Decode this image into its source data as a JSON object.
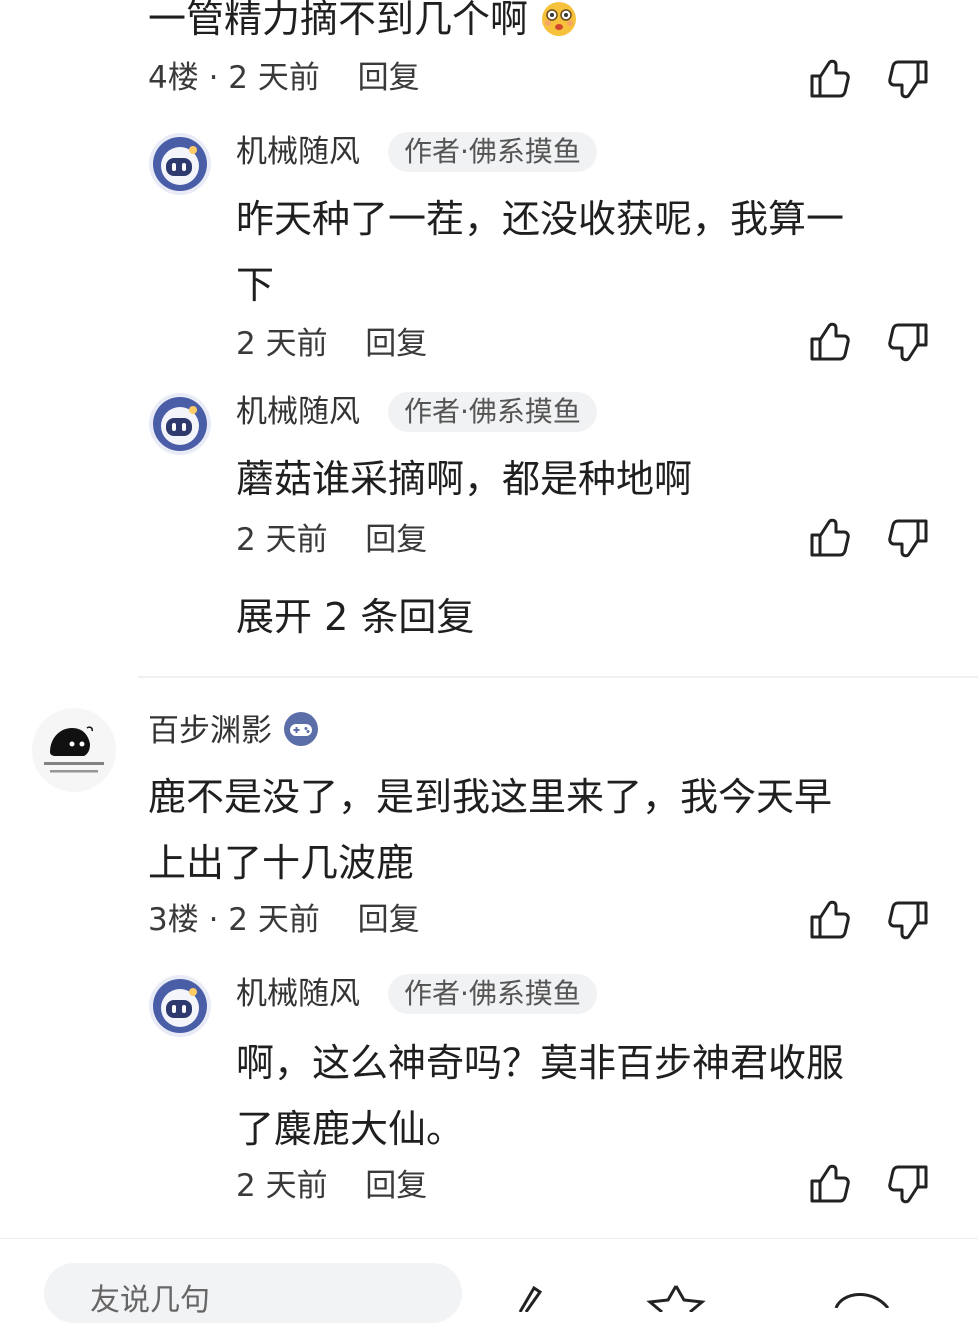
{
  "thread": {
    "prev_comment_tail": "一管精力摘不到几个啊",
    "comments": [
      {
        "floor_meta": "4楼 · 2 天前",
        "reply_label": "回复",
        "replies": [
          {
            "author": "机械随风",
            "badge": "作者·佛系摸鱼",
            "text_line1": "昨天种了一茬，还没收获呢，我算一",
            "text_line2": "下",
            "meta": "2 天前",
            "reply_label": "回复"
          },
          {
            "author": "机械随风",
            "badge": "作者·佛系摸鱼",
            "text_line1": "蘑菇谁采摘啊，都是种地啊",
            "meta": "2 天前",
            "reply_label": "回复"
          }
        ],
        "expand_label": "展开 2 条回复"
      },
      {
        "author": "百步渊影",
        "text_line1": "鹿不是没了，是到我这里来了，我今天早",
        "text_line2": "上出了十几波鹿",
        "floor_meta": "3楼 · 2 天前",
        "reply_label": "回复",
        "replies": [
          {
            "author": "机械随风",
            "badge": "作者·佛系摸鱼",
            "text_line1": "啊，这么神奇吗？莫非百步神君收服",
            "text_line2": "了麋鹿大仙。",
            "meta": "2 天前",
            "reply_label": "回复"
          }
        ]
      }
    ]
  },
  "bottom_bar": {
    "input_placeholder": "友说几句"
  },
  "icons": {
    "like": "thumbs-up-icon",
    "dislike": "thumbs-down-icon",
    "emoji": "shocked-emoji-icon",
    "game": "gamepad-badge-icon"
  },
  "colors": {
    "text": "#1f1f1f",
    "meta": "#3a3a3a",
    "badge_bg": "#f1f2f4",
    "robot_avatar": "#4a5ea8"
  }
}
